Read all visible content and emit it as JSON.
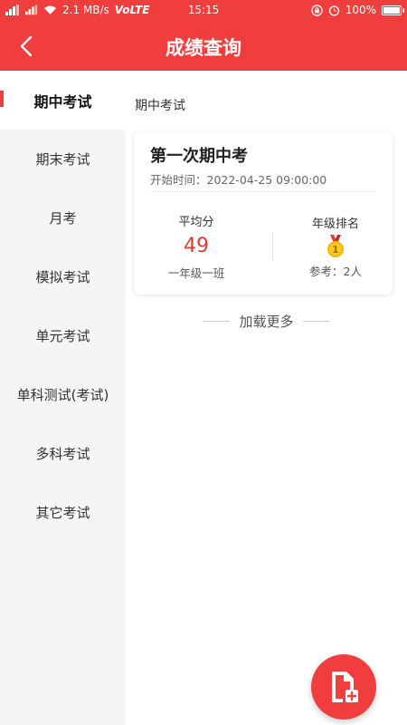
{
  "status_bar": {
    "speed": "2.1 MB/s",
    "network": "VoLTE",
    "time": "15:15",
    "battery": "100%"
  },
  "header": {
    "title": "成绩查询",
    "back_icon": "chevron-left-icon"
  },
  "sidebar": {
    "items": [
      {
        "label": "期中考试",
        "active": true
      },
      {
        "label": "期末考试",
        "active": false
      },
      {
        "label": "月考",
        "active": false
      },
      {
        "label": "模拟考试",
        "active": false
      },
      {
        "label": "单元考试",
        "active": false
      },
      {
        "label": "单科测试(考试)",
        "active": false
      },
      {
        "label": "多科考试",
        "active": false
      },
      {
        "label": "其它考试",
        "active": false
      }
    ]
  },
  "main": {
    "section_title": "期中考试",
    "exam_card": {
      "title": "第一次期中考",
      "start_time": "开始时间：2022-04-25 09:00:00",
      "average_label": "平均分",
      "average_value": "49",
      "class_name": "一年级一班",
      "rank_label": "年级排名",
      "rank_value": "1",
      "participants": "参考：2人"
    },
    "load_more": "加载更多"
  },
  "fab": {
    "icon": "add-document-icon"
  },
  "colors": {
    "accent": "#f03e3e",
    "score": "#e53935",
    "medal": "#f5b800"
  }
}
